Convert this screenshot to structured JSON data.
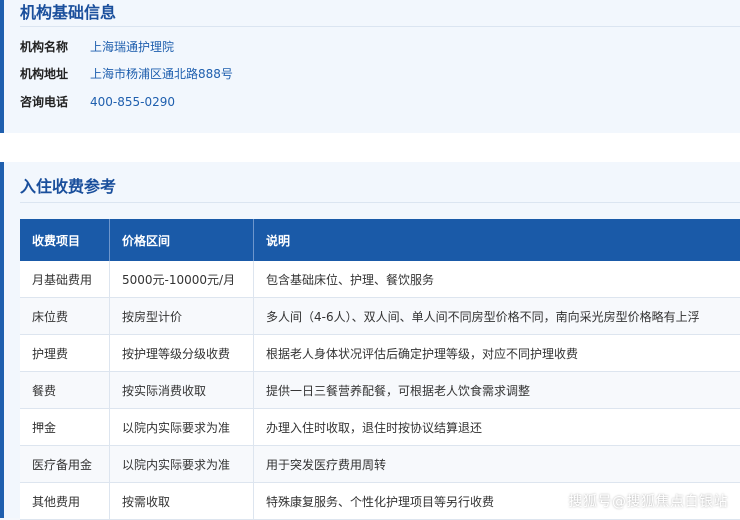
{
  "basic": {
    "title": "机构基础信息",
    "rows": [
      {
        "label": "机构名称",
        "value": "上海瑞通护理院"
      },
      {
        "label": "机构地址",
        "value": "上海市杨浦区通北路888号"
      },
      {
        "label": "咨询电话",
        "value": "400-855-0290"
      }
    ]
  },
  "fees": {
    "title": "入住收费参考",
    "headers": [
      "收费项目",
      "价格区间",
      "说明"
    ],
    "rows": [
      [
        "月基础费用",
        "5000元-10000元/月",
        "包含基础床位、护理、餐饮服务"
      ],
      [
        "床位费",
        "按房型计价",
        "多人间（4-6人）、双人间、单人间不同房型价格不同，南向采光房型价格略有上浮"
      ],
      [
        "护理费",
        "按护理等级分级收费",
        "根据老人身体状况评估后确定护理等级，对应不同护理收费"
      ],
      [
        "餐费",
        "按实际消费收取",
        "提供一日三餐营养配餐，可根据老人饮食需求调整"
      ],
      [
        "押金",
        "以院内实际要求为准",
        "办理入住时收取，退住时按协议结算退还"
      ],
      [
        "医疗备用金",
        "以院内实际要求为准",
        "用于突发医疗费用周转"
      ],
      [
        "其他费用",
        "按需收取",
        "特殊康复服务、个性化护理项目等另行收费"
      ]
    ]
  },
  "watermark": "搜狐号@搜狐焦点白银站",
  "colors": {
    "accent": "#1a5aa8",
    "title": "#1a4f9c",
    "link": "#1f5fae"
  }
}
